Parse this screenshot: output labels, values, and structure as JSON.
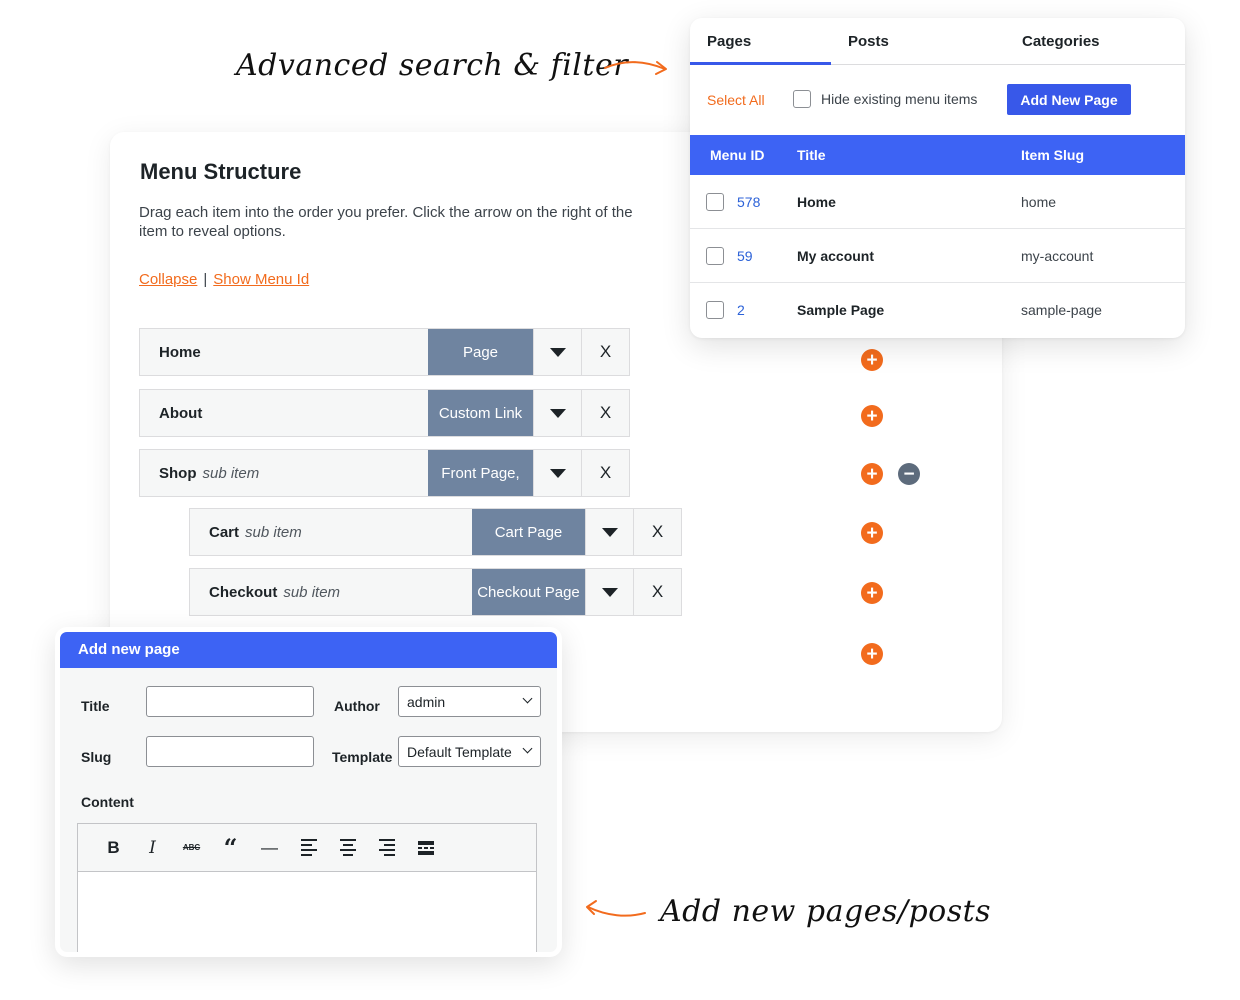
{
  "annotations": {
    "top": "Advanced search & filter",
    "bottom": "Add new pages/posts"
  },
  "menu_structure": {
    "title": "Menu Structure",
    "description": "Drag each item into the order you prefer. Click the arrow on the right of the item to reveal options.",
    "collapse_link": "Collapse",
    "separator": "|",
    "show_menu_id_link": "Show Menu Id",
    "remove_label": "X",
    "items": [
      {
        "label": "Home",
        "sub": "",
        "type": "Page"
      },
      {
        "label": "About",
        "sub": "",
        "type": "Custom Link"
      },
      {
        "label": "Shop",
        "sub": "sub item",
        "type": "Front Page,"
      },
      {
        "label": "Cart",
        "sub": "sub item",
        "type": "Cart Page"
      },
      {
        "label": "Checkout",
        "sub": "sub item",
        "type": "Checkout Page"
      }
    ],
    "add_symbol": "+",
    "remove_symbol": "−"
  },
  "filter": {
    "tabs": [
      "Pages",
      "Posts",
      "Categories"
    ],
    "active_tab": "Pages",
    "select_all": "Select All",
    "hide_existing": "Hide existing menu items",
    "add_new_page": "Add New Page",
    "columns": [
      "Menu ID",
      "Title",
      "Item Slug"
    ],
    "rows": [
      {
        "id": "578",
        "title": "Home",
        "slug": "home"
      },
      {
        "id": "59",
        "title": "My account",
        "slug": "my-account"
      },
      {
        "id": "2",
        "title": "Sample Page",
        "slug": "sample-page"
      }
    ]
  },
  "add_page": {
    "header": "Add new page",
    "title_label": "Title",
    "title_value": "",
    "author_label": "Author",
    "author_value": "admin",
    "slug_label": "Slug",
    "slug_value": "",
    "template_label": "Template",
    "template_value": "Default Template",
    "content_label": "Content",
    "toolbar": {
      "bold": "B",
      "italic": "I",
      "strikethrough": "ABC",
      "quote": "“",
      "hr": "—"
    },
    "toolbar_icons": [
      "bold-icon",
      "italic-icon",
      "strikethrough-icon",
      "blockquote-icon",
      "horizontal-rule-icon",
      "align-left-icon",
      "align-center-icon",
      "align-right-icon",
      "read-more-icon"
    ]
  },
  "colors": {
    "accent_orange": "#f26b1d",
    "primary_blue": "#3d63f4",
    "type_badge": "#6f84a0",
    "minus_button": "#5d6b7c"
  }
}
